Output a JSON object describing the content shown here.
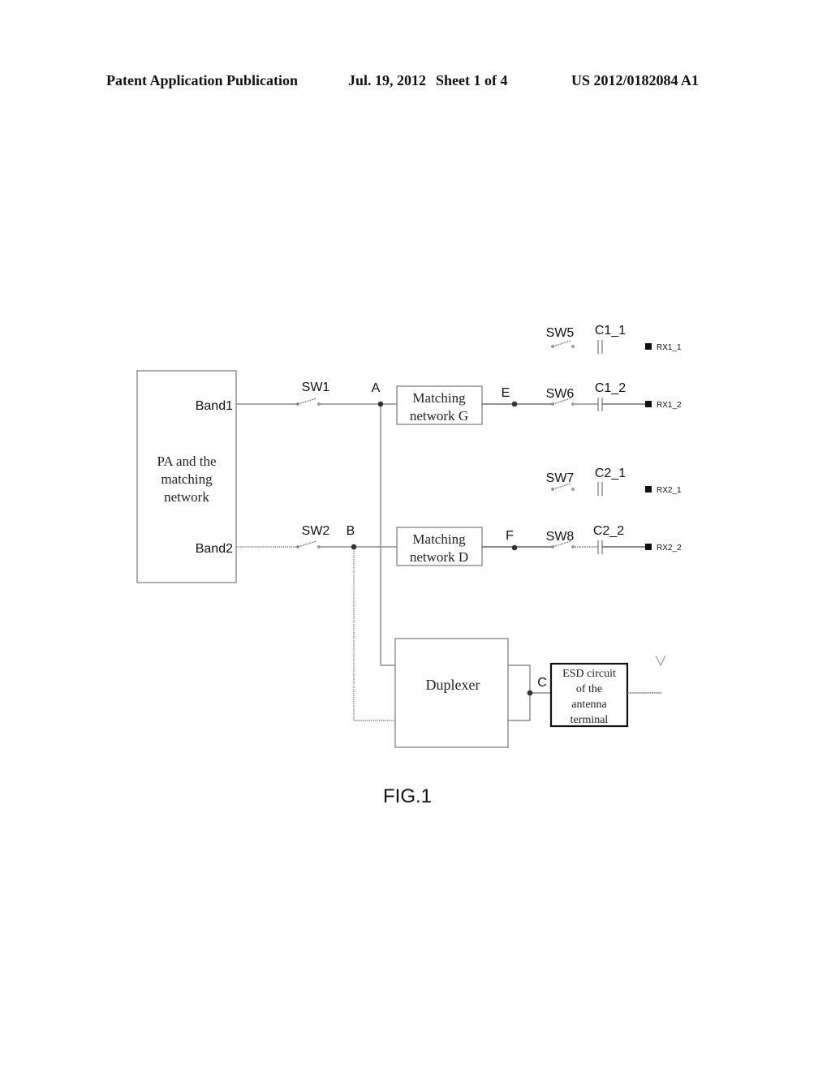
{
  "header": {
    "publication_type": "Patent Application Publication",
    "date": "Jul. 19, 2012",
    "sheet": "Sheet 1 of 4",
    "patent_number": "US 2012/0182084 A1"
  },
  "figure": {
    "caption": "FIG.1",
    "blocks": {
      "pa_line1": "PA and the",
      "pa_line2": "matching",
      "pa_line3": "network",
      "band1": "Band1",
      "band2": "Band2",
      "matching_g_line1": "Matching",
      "matching_g_line2": "network G",
      "matching_d_line1": "Matching",
      "matching_d_line2": "network D",
      "duplexer": "Duplexer",
      "esd_line1": "ESD circuit",
      "esd_line2": "of the",
      "esd_line3": "antenna",
      "esd_line4": "terminal"
    },
    "switches": {
      "sw1": "SW1",
      "sw2": "SW2",
      "sw5": "SW5",
      "sw6": "SW6",
      "sw7": "SW7",
      "sw8": "SW8"
    },
    "capacitors": {
      "c1_1": "C1_1",
      "c1_2": "C1_2",
      "c2_1": "C2_1",
      "c2_2": "C2_2"
    },
    "nodes": {
      "a": "A",
      "b": "B",
      "c": "C",
      "e": "E",
      "f": "F"
    },
    "ports": {
      "rx1_1": "RX1_1",
      "rx1_2": "RX1_2",
      "rx2_1": "RX2_1",
      "rx2_2": "RX2_2"
    }
  }
}
